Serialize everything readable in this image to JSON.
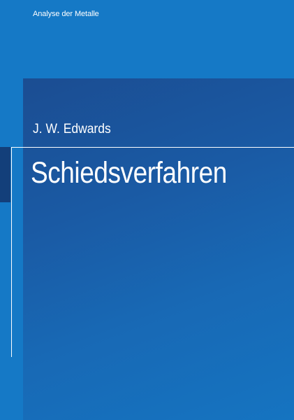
{
  "series": "Analyse der Metalle",
  "author": "J. W. Edwards",
  "title": "Schiedsverfahren",
  "colors": {
    "background": "#1579c6",
    "panel_top": "#1b4d92",
    "panel_bottom": "#1574c1",
    "edge_band": "#133f7a",
    "text": "#ffffff"
  }
}
